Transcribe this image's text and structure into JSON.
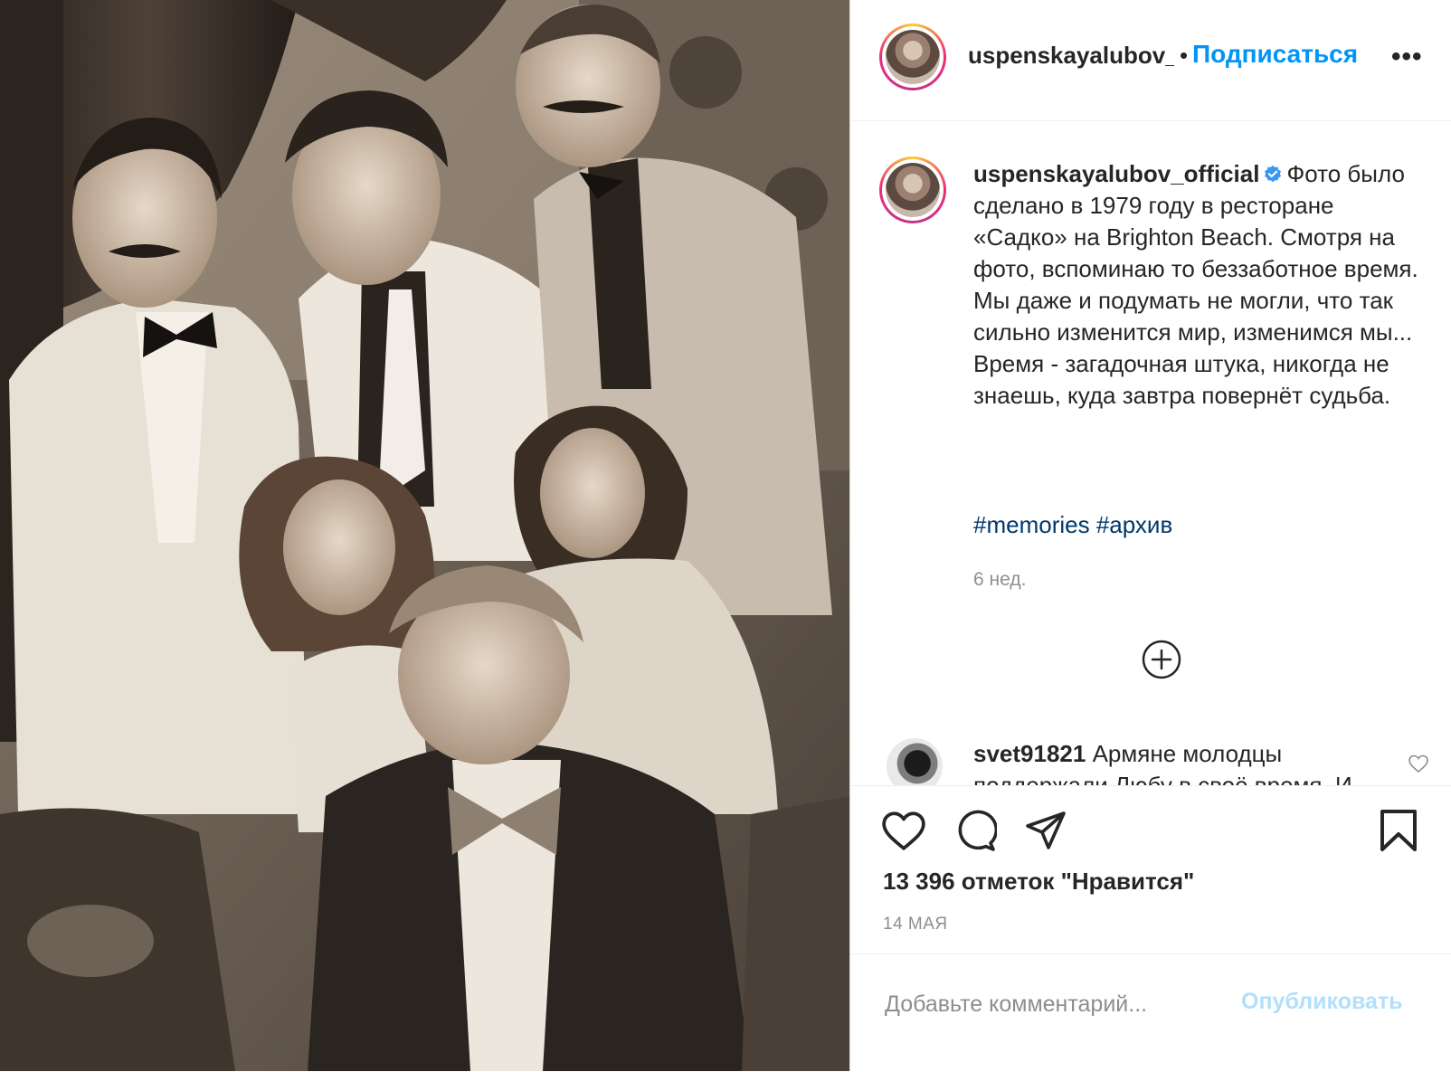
{
  "photo": {
    "alt": ""
  },
  "header": {
    "username": "uspenskayalubov_official",
    "separator": "•",
    "follow_label": "Подписаться",
    "more_icon": "ellipsis-icon"
  },
  "caption": {
    "username": "uspenskayalubov_official",
    "verified_icon": "verified-badge-icon",
    "text": "Фото было сделано в 1979 году в ресторане «Садко» на Brighton Beach. Смотря на фото, вспоминаю то беззаботное время. Мы даже и подумать не могли, что так сильно изменится мир, изменимся мы... Время - загадочная штука, никогда не знаешь, куда завтра повернёт судьба.",
    "hashtags": [
      "#memories",
      "#архив"
    ],
    "time_ago": "6 нед."
  },
  "load_more_icon": "plus-circle-icon",
  "comments": [
    {
      "username": "svet91821",
      "text": "Армяне молодцы поддержали Любу в своё время. И",
      "like_icon": "heart-outline-icon"
    }
  ],
  "actions": {
    "like_icon": "heart-outline-icon",
    "comment_icon": "comment-bubble-icon",
    "share_icon": "paper-plane-icon",
    "save_icon": "bookmark-icon",
    "likes_text": "13 396 отметок \"Нравится\"",
    "date": "14 МАЯ"
  },
  "add_comment": {
    "placeholder": "Добавьте комментарий...",
    "publish_label": "Опубликовать"
  },
  "colors": {
    "accent": "#0095f6",
    "hashtag": "#00376b",
    "muted": "#8e8e8e",
    "publish_disabled": "#b2dffc"
  }
}
